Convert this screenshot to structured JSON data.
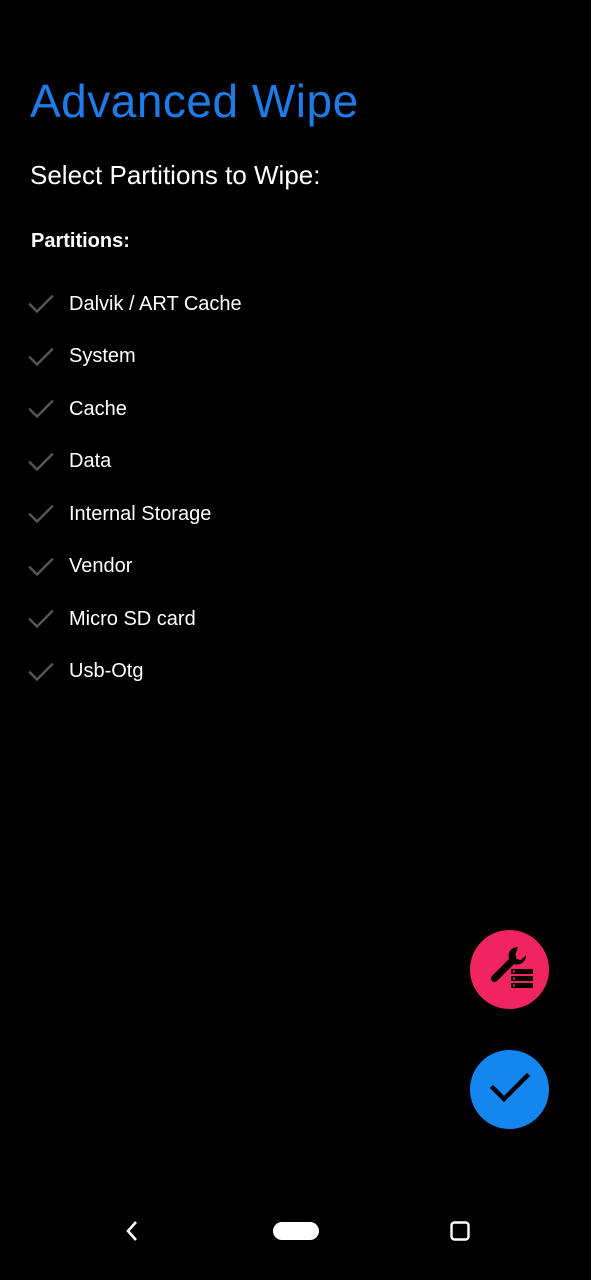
{
  "header": {
    "title": "Advanced Wipe",
    "subtitle": "Select Partitions to Wipe:"
  },
  "partitions": {
    "label": "Partitions:",
    "items": [
      {
        "label": "Dalvik / ART Cache",
        "checked": false
      },
      {
        "label": "System",
        "checked": false
      },
      {
        "label": "Cache",
        "checked": false
      },
      {
        "label": "Data",
        "checked": false
      },
      {
        "label": "Internal Storage",
        "checked": false
      },
      {
        "label": "Vendor",
        "checked": false
      },
      {
        "label": "Micro SD card",
        "checked": false
      },
      {
        "label": "Usb-Otg",
        "checked": false
      }
    ]
  },
  "fabs": {
    "tools": {
      "icon": "wrench-list-icon",
      "color": "#f0245e"
    },
    "confirm": {
      "icon": "check-icon",
      "color": "#1585f0"
    }
  },
  "navigation": {
    "back_icon": "back-chevron-icon",
    "home_icon": "home-pill-icon",
    "recents_icon": "recents-square-icon"
  },
  "colors": {
    "background": "#000000",
    "accent": "#1e7ce8",
    "unchecked_mark": "#555555"
  }
}
